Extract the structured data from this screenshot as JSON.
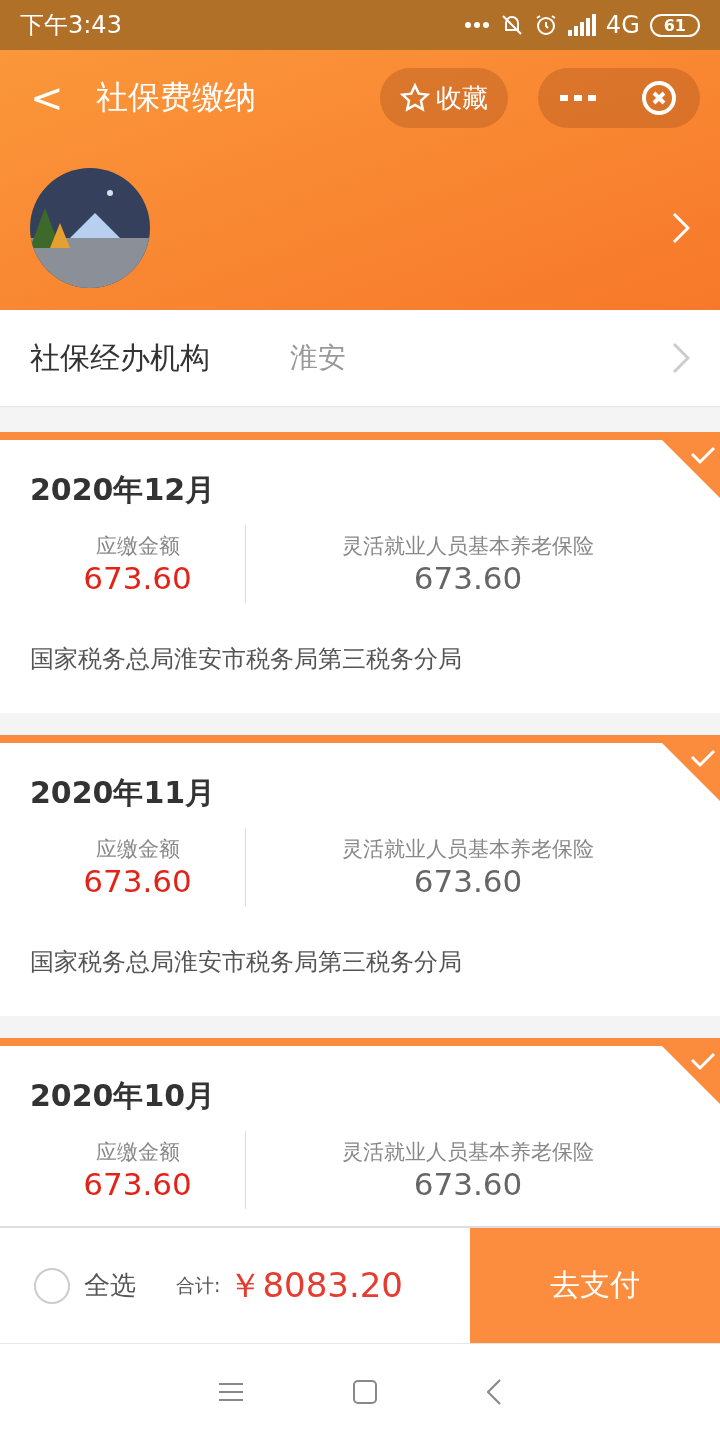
{
  "status_bar": {
    "time": "下午3:43",
    "network": "4G",
    "battery": "61"
  },
  "header": {
    "back": "<",
    "title": "社保费缴纳",
    "favorite": "收藏"
  },
  "org": {
    "label": "社保经办机构",
    "value": "淮安"
  },
  "bills": [
    {
      "month": "2020年12月",
      "due_label": "应缴金额",
      "due": "673.60",
      "item_label": "灵活就业人员基本养老保险",
      "item_amount": "673.60",
      "office": "国家税务总局淮安市税务局第三税务分局",
      "selected": true
    },
    {
      "month": "2020年11月",
      "due_label": "应缴金额",
      "due": "673.60",
      "item_label": "灵活就业人员基本养老保险",
      "item_amount": "673.60",
      "office": "国家税务总局淮安市税务局第三税务分局",
      "selected": true
    },
    {
      "month": "2020年10月",
      "due_label": "应缴金额",
      "due": "673.60",
      "item_label": "灵活就业人员基本养老保险",
      "item_amount": "673.60",
      "selected": true
    }
  ],
  "footer": {
    "select_all": "全选",
    "select_all_checked": false,
    "total_label": "合计:",
    "total": "￥8083.20",
    "pay": "去支付"
  }
}
